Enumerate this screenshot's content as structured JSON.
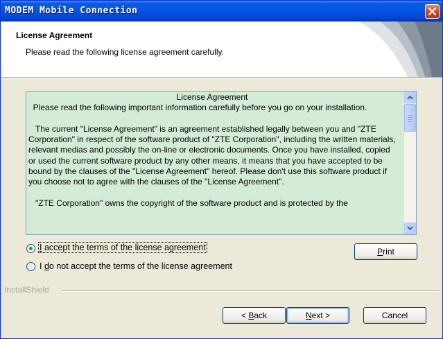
{
  "window": {
    "title": "MODEM Mobile Connection"
  },
  "header": {
    "title": "License Agreement",
    "subtitle": "Please read the following license agreement carefully."
  },
  "license": {
    "heading": "License Agreement",
    "intro": "  Please read the following important information carefully before you go on your installation.",
    "para1": "   The current \"License Agreement\" is an agreement established legally between you and \"ZTE Corporation\" in respect of the software product of \"ZTE Corporation\", including the written materials, relevant medias and possibly the on-line or electronic documents. Once you have installed, copied or used the current software product by any other means, it means that you have accepted to be bound by the clauses of the \"License Agreement\" hereof. Please don't use this software product if you choose not to agree with the clauses of the \"License Agreement\".",
    "para2": "   \"ZTE Corporation\" owns the copyright of the software product and is protected by the"
  },
  "options": {
    "accept_prefix": "I",
    "accept_rest": " accept the terms of the license agreement",
    "decline_prefix": "I ",
    "decline_mnemonic": "d",
    "decline_rest": "o not accept the terms of the license agreement",
    "selected": "accept"
  },
  "buttons": {
    "print_mnemonic": "P",
    "print_rest": "rint",
    "back_prefix": "< ",
    "back_mnemonic": "B",
    "back_rest": "ack",
    "next_mnemonic": "N",
    "next_rest": "ext >",
    "cancel": "Cancel"
  },
  "footer": {
    "brand": "InstallShield"
  }
}
